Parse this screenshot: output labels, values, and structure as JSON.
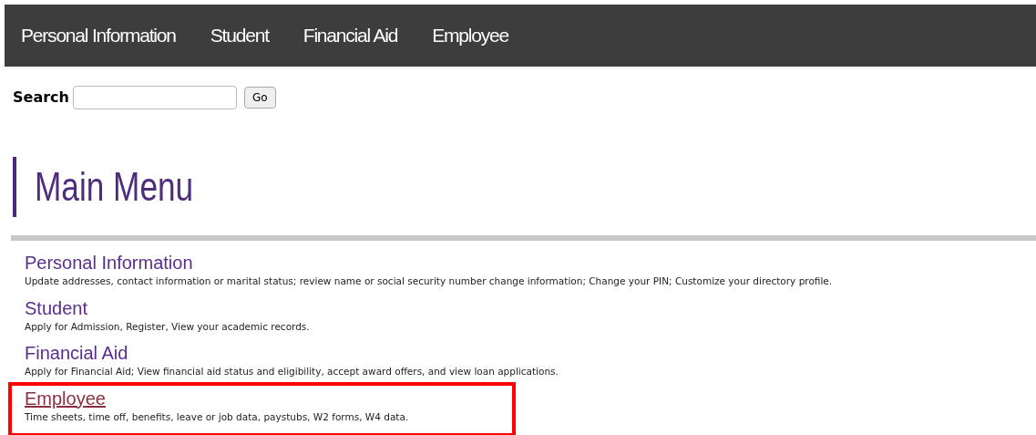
{
  "nav": {
    "items": [
      "Personal Information",
      "Student",
      "Financial Aid",
      "Employee"
    ]
  },
  "search": {
    "label": "Search",
    "button": "Go"
  },
  "heading": "Main Menu",
  "menu": [
    {
      "title": "Personal Information",
      "description": "Update addresses, contact information or marital status; review name or social security number change information; Change your PIN; Customize your directory profile.",
      "visited": false,
      "highlighted": false
    },
    {
      "title": "Student",
      "description": "Apply for Admission, Register, View your academic records.",
      "visited": false,
      "highlighted": false
    },
    {
      "title": "Financial Aid",
      "description": "Apply for Financial Aid; View financial aid status and eligibility, accept award offers, and view loan applications.",
      "visited": false,
      "highlighted": false
    },
    {
      "title": "Employee",
      "description": "Time sheets, time off, benefits, leave or job data, paystubs, W2 forms, W4 data.",
      "visited": true,
      "highlighted": true
    }
  ]
}
